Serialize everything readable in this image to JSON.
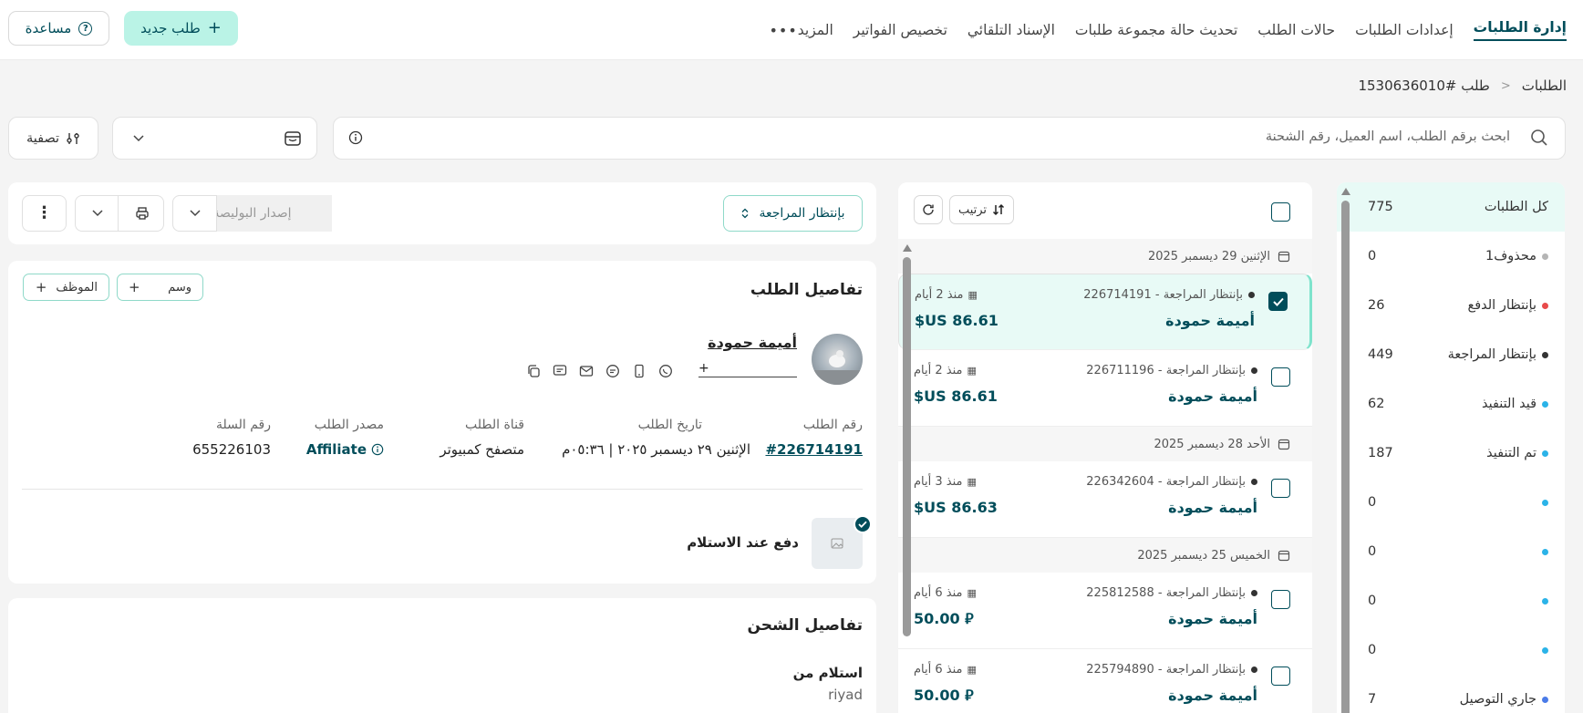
{
  "nav": {
    "tabs": [
      {
        "label": "إدارة الطلبات",
        "active": true
      },
      {
        "label": "إعدادات الطلبات"
      },
      {
        "label": "حالات الطلب"
      },
      {
        "label": "تحديث حالة مجموعة طلبات"
      },
      {
        "label": "الإسناد التلقائي"
      },
      {
        "label": "تخصيص الفواتير"
      },
      {
        "label": "المزيد"
      }
    ],
    "new_order": "طلب جديد",
    "help": "مساعدة"
  },
  "breadcrumb": {
    "root": "الطلبات",
    "current": "طلب #1530636010"
  },
  "search": {
    "placeholder": "ابحث برقم الطلب، اسم العميل، رقم الشحنة"
  },
  "filter_label": "تصفية",
  "statuses": [
    {
      "label": "كل الطلبات",
      "count": "775",
      "color": ""
    },
    {
      "label": "محذوف1",
      "count": "0",
      "color": "#b5b5b5"
    },
    {
      "label": "بإنتظار الدفع",
      "count": "26",
      "color": "#e84a4a"
    },
    {
      "label": "بإنتظار المراجعة",
      "count": "449",
      "color": "#333333"
    },
    {
      "label": "قيد التنفيذ",
      "count": "62",
      "color": "#2bb3e8"
    },
    {
      "label": "تم التنفيذ",
      "count": "187",
      "color": "#2bb3e8"
    },
    {
      "label": "",
      "count": "0",
      "color": "#2bb3e8"
    },
    {
      "label": "",
      "count": "0",
      "color": "#2bb3e8"
    },
    {
      "label": "",
      "count": "0",
      "color": "#2bb3e8"
    },
    {
      "label": "",
      "count": "0",
      "color": "#2bb3e8"
    },
    {
      "label": "جاري التوصيل",
      "count": "7",
      "color": "#4a7be8"
    }
  ],
  "list": {
    "sort_label": "ترتيب",
    "groups": [
      {
        "date": "الإثنين 29 ديسمبر 2025"
      },
      {
        "date": "الأحد 28 ديسمبر 2025"
      },
      {
        "date": "الخميس 25 ديسمبر 2025"
      }
    ],
    "orders": [
      {
        "meta": "بإنتظار المراجعة - 226714191",
        "name": "أميمة حمودة",
        "ago": "منذ 2 أيام",
        "price": "$US 86.61",
        "selected": true
      },
      {
        "meta": "بإنتظار المراجعة - 226711196",
        "name": "أميمة حمودة",
        "ago": "منذ 2 أيام",
        "price": "$US 86.61"
      },
      {
        "meta": "بإنتظار المراجعة - 226342604",
        "name": "أميمة حمودة",
        "ago": "منذ 3 أيام",
        "price": "$US 86.63"
      },
      {
        "meta": "بإنتظار المراجعة - 225812588",
        "name": "أميمة حمودة",
        "ago": "منذ 6 أيام",
        "price": "50.00 ⃁"
      },
      {
        "meta": "بإنتظار المراجعة - 225794890",
        "name": "أميمة حمودة",
        "ago": "منذ 6 أيام",
        "price": "50.00 ⃁"
      }
    ]
  },
  "actions": {
    "status": "بإنتظار المراجعة",
    "issue_waybill": "إصدار البوليصة"
  },
  "details": {
    "title": "تفاصيل الطلب",
    "tag_label": "وسم",
    "employee_label": "الموظف",
    "customer_name": "أميمة حمودة",
    "fields": [
      {
        "label": "رقم الطلب",
        "value": "#226714191"
      },
      {
        "label": "تاريخ الطلب",
        "value": "الإثنين ٢٩ ديسمبر ٢٠٢٥ | ٠٥:٣٦م"
      },
      {
        "label": "قناة الطلب",
        "value": "متصفح كمبيوتر"
      },
      {
        "label": "مصدر الطلب",
        "value": "Affiliate"
      },
      {
        "label": "رقم السلة",
        "value": "655226103"
      }
    ],
    "payment": "دفع عند الاستلام"
  },
  "shipping": {
    "title": "تفاصيل الشحن",
    "pickup_label": "استلام من",
    "pickup_value": "riyad"
  },
  "colors": {
    "brand": "#004d5a",
    "accent": "#baf3e6",
    "selected_row": "#e8faf6"
  }
}
